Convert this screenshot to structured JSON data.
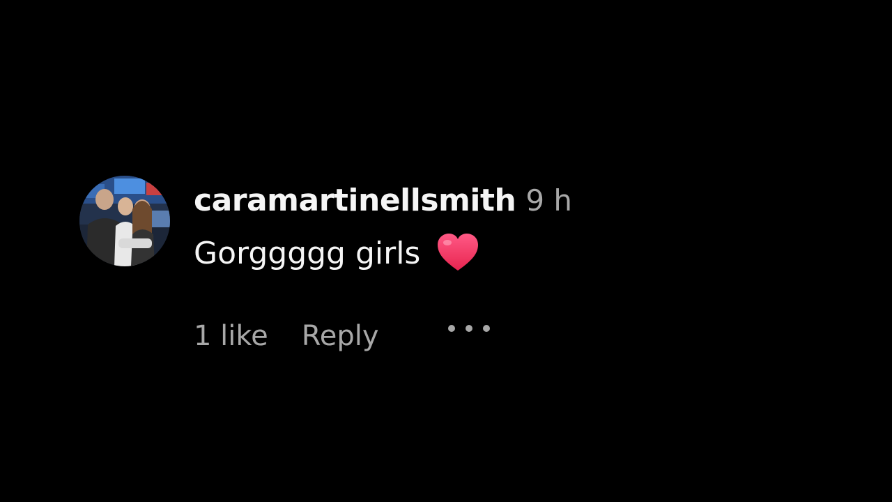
{
  "comment": {
    "username": "caramartinellsmith",
    "timestamp": "9 h",
    "text": "Gorggggg girls",
    "emoji": "heart-emoji",
    "likes_label": "1 like",
    "reply_label": "Reply",
    "more_icon": "more-options-icon"
  },
  "colors": {
    "background": "#000000",
    "primary_text": "#f5f5f5",
    "secondary_text": "#a8a8a8",
    "heart": "#ff3a6e"
  }
}
